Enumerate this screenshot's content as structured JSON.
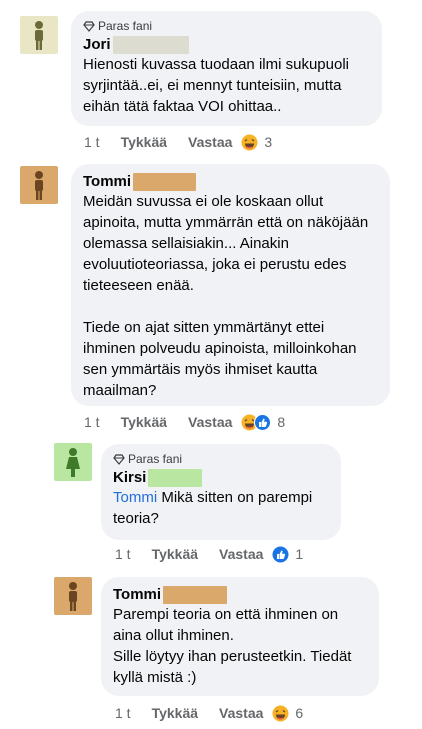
{
  "comments": [
    {
      "badge": "Paras fani",
      "author": "Jori",
      "text": "Hienosti kuvassa tuodaan ilmi sukupuoli syrjintää..ei, ei mennyt tunteisiin, mutta eihän tätä faktaa VOI ohittaa..",
      "time": "1 t",
      "like": "Tykkää",
      "reply": "Vastaa",
      "reactions": [
        "haha-icon"
      ],
      "count": "3"
    },
    {
      "author": "Tommi",
      "text": "Meidän suvussa ei ole koskaan ollut apinoita, mutta ymmärrän että on näköjään olemassa sellaisiakin... Ainakin evoluutioteoriassa, joka ei perustu edes tieteeseen enää.\n\nTiede on ajat sitten ymmärtänyt ettei ihminen polveudu apinoista, milloinkohan sen ymmärtäis myös ihmiset kautta maailman?",
      "time": "1 t",
      "like": "Tykkää",
      "reply": "Vastaa",
      "reactions": [
        "haha-icon",
        "like-icon"
      ],
      "count": "8"
    },
    {
      "badge": "Paras fani",
      "author": "Kirsi",
      "mention": "Tommi",
      "text": " Mikä sitten on parempi teoria?",
      "time": "1 t",
      "like": "Tykkää",
      "reply": "Vastaa",
      "reactions": [
        "like-icon"
      ],
      "count": "1"
    },
    {
      "author": "Tommi",
      "text": "Parempi teoria on että ihminen on aina ollut ihminen.\nSille löytyy ihan perusteetkin. Tiedät kyllä mistä :)",
      "time": "1 t",
      "like": "Tykkää",
      "reply": "Vastaa",
      "reactions": [
        "haha-icon"
      ],
      "count": "6"
    }
  ],
  "colors": {
    "bubble": "#f0f2f5",
    "mention": "#216fdb",
    "meta": "#65676b",
    "avatar_olive": "#e8e6c4",
    "avatar_brown": "#d9a86a",
    "avatar_green": "#b9e6a0"
  }
}
